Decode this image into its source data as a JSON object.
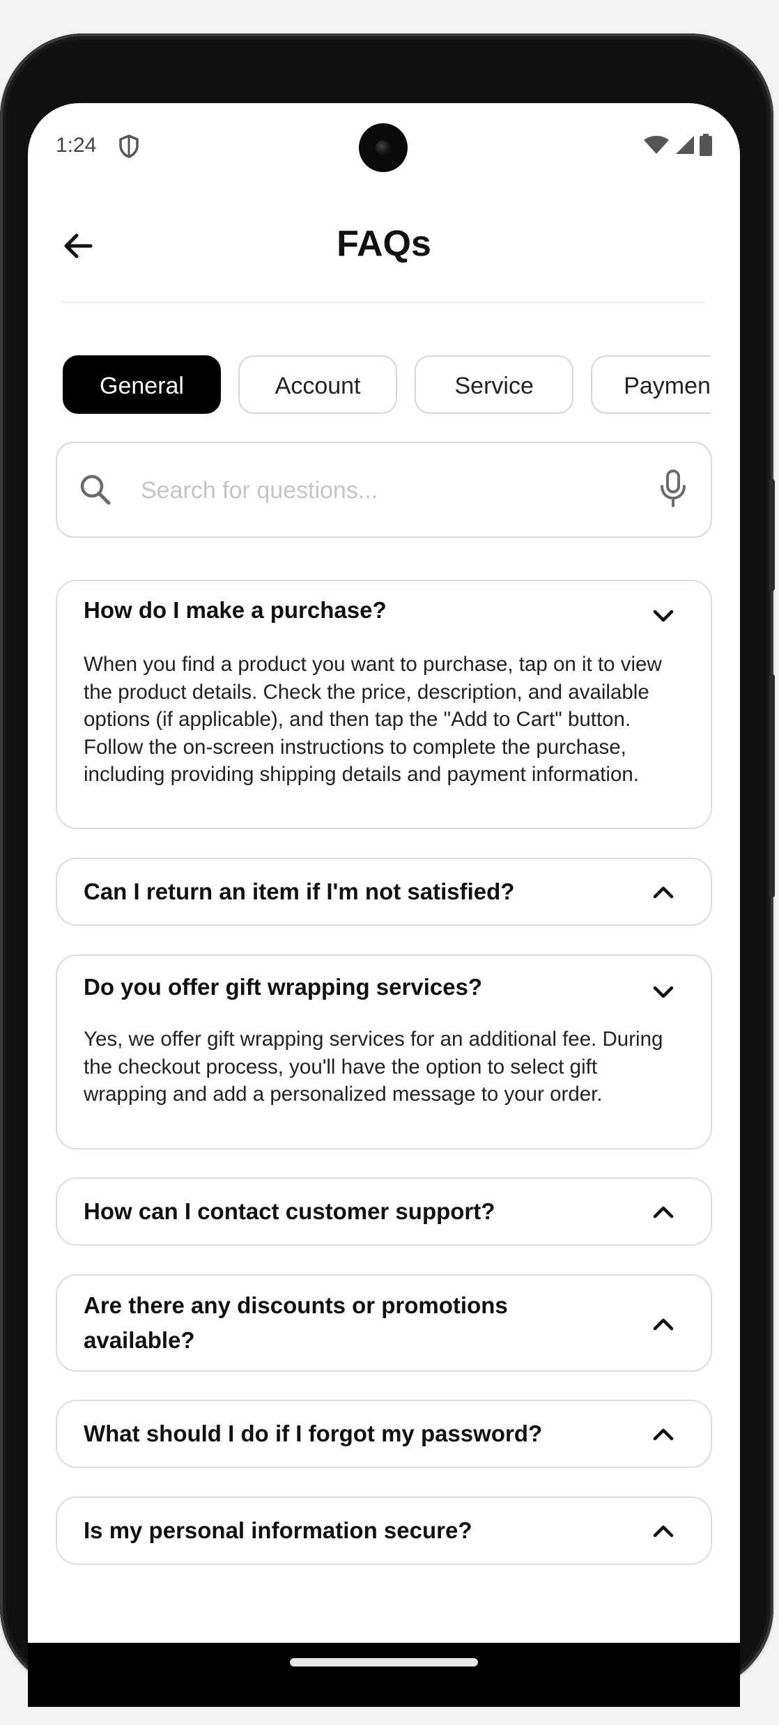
{
  "status_bar": {
    "time": "1:24"
  },
  "header": {
    "title": "FAQs"
  },
  "tabs": [
    {
      "label": "General",
      "active": true
    },
    {
      "label": "Account",
      "active": false
    },
    {
      "label": "Service",
      "active": false
    },
    {
      "label": "Payment",
      "active": false
    }
  ],
  "search": {
    "placeholder": "Search for questions...",
    "value": ""
  },
  "faqs": [
    {
      "question": "How do I make a purchase?",
      "expanded": true,
      "answer": "When you find a product you want to purchase, tap on it to view the product details. Check the price, description, and available options (if applicable), and then tap the \"Add to Cart\" button. Follow the on-screen instructions to complete the purchase, including providing shipping details and payment information."
    },
    {
      "question": "Can I return an item if I'm not satisfied?",
      "expanded": false
    },
    {
      "question": "Do you offer gift wrapping services?",
      "expanded": true,
      "answer": "Yes, we offer gift wrapping services for an additional fee. During the checkout process, you'll have the option to select gift wrapping and add a personalized message to your order."
    },
    {
      "question": "How can I contact customer support?",
      "expanded": false
    },
    {
      "question": "Are there any discounts or promotions available?",
      "expanded": false
    },
    {
      "question": "What should I do if I forgot my password?",
      "expanded": false
    },
    {
      "question": "Is my personal information secure?",
      "expanded": false
    }
  ],
  "colors": {
    "accent": "#000000",
    "border": "#dcdcdc",
    "placeholder": "#c4c4c4"
  },
  "icons": [
    "back-arrow-icon",
    "search-icon",
    "mic-icon",
    "chevron-down-icon",
    "chevron-up-icon",
    "shield-icon",
    "wifi-icon",
    "signal-icon",
    "battery-icon"
  ]
}
